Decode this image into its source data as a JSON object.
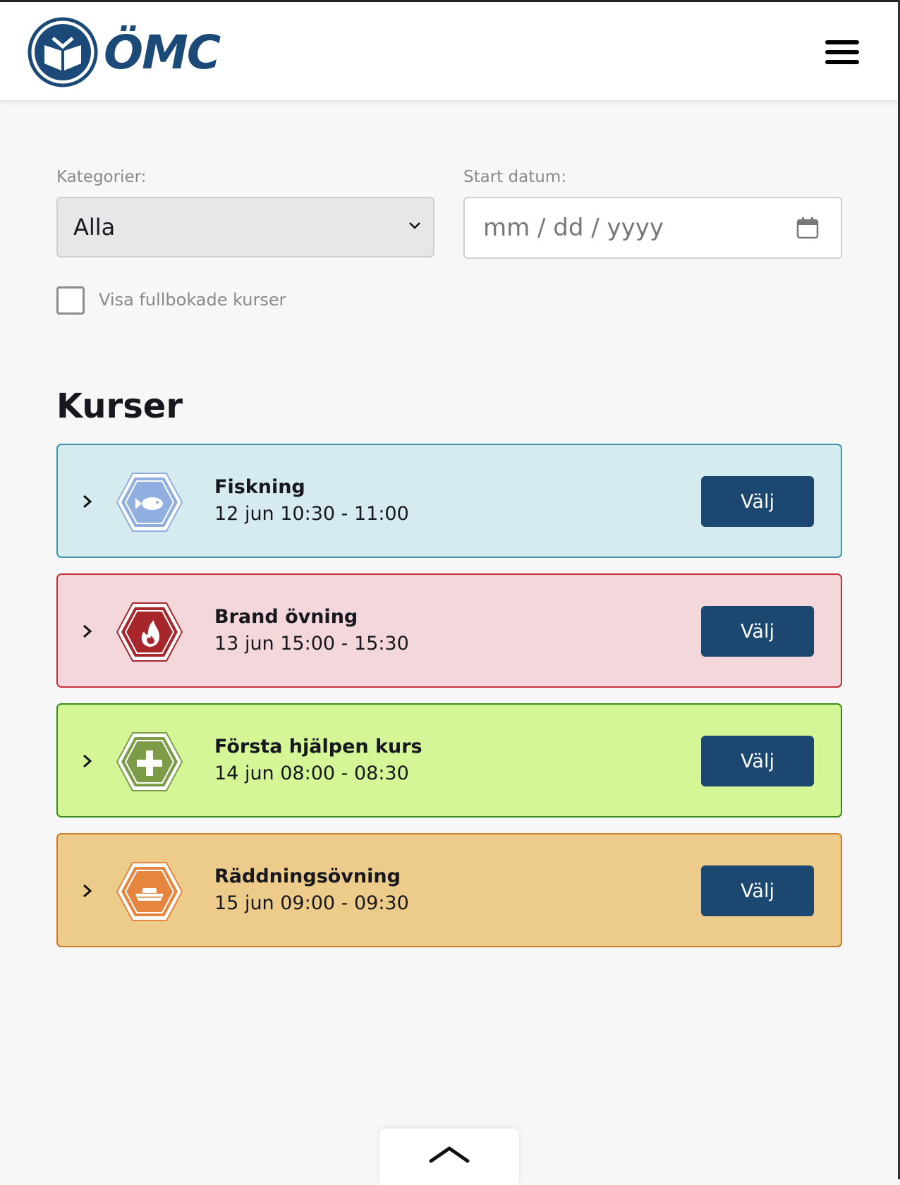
{
  "header": {
    "logo_text": "ÖMC"
  },
  "filters": {
    "category_label": "Kategorier:",
    "category_value": "Alla",
    "date_label": "Start datum:",
    "date_placeholder": "mm / dd / yyyy",
    "fullbooked_label": "Visa fullbokade kurser"
  },
  "courses_section": {
    "title": "Kurser",
    "items": [
      {
        "title": "Fiskning",
        "time": "12 jun 10:30 - 11:00",
        "button": "Välj",
        "icon": "fish-icon",
        "bg": "#d6ebf0",
        "border": "#3a95ad",
        "icon_color": "#90aee0"
      },
      {
        "title": "Brand övning",
        "time": "13 jun 15:00 - 15:30",
        "button": "Välj",
        "icon": "flame-icon",
        "bg": "#f3d7db",
        "border": "#c4303a",
        "icon_color": "#a7262c"
      },
      {
        "title": "Första hjälpen kurs",
        "time": "14 jun 08:00 - 08:30",
        "button": "Välj",
        "icon": "plus-icon",
        "bg": "#d5f697",
        "border": "#3c8a1e",
        "icon_color": "#7d9c48"
      },
      {
        "title": "Räddningsövning",
        "time": "15 jun 09:00 - 09:30",
        "button": "Välj",
        "icon": "boat-icon",
        "bg": "#eccb8b",
        "border": "#cc7a2a",
        "icon_color": "#e6853d"
      }
    ]
  }
}
